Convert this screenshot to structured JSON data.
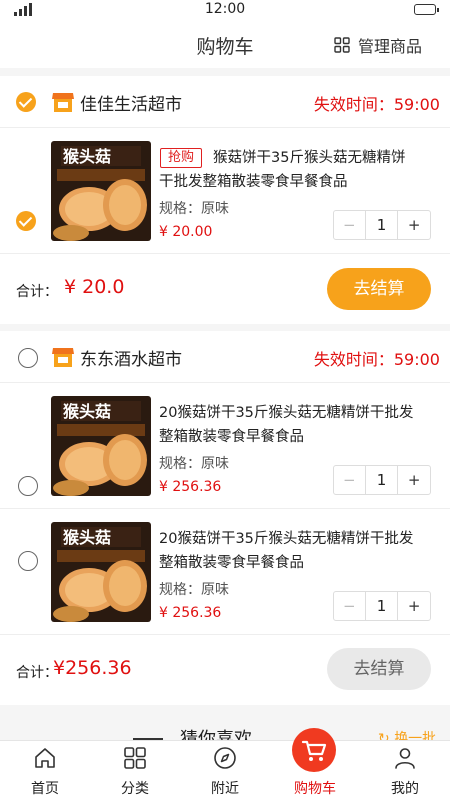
{
  "status_bar": {
    "time": "12:00"
  },
  "header": {
    "title": "购物车",
    "manage_label": "管理商品"
  },
  "stores": [
    {
      "name": "佳佳生活超市",
      "expire_text": "失效时间：59:00",
      "selected": true,
      "items": [
        {
          "selected": true,
          "tag": "抢购",
          "name": "猴菇饼干35斤猴头菇无糖精饼干批发整箱散装零食早餐食品",
          "spec": "规格：原味",
          "price": "¥ 20.00",
          "quantity": "1",
          "image_text": "猴头菇"
        }
      ],
      "total_label": "合计：",
      "total_value": "¥ 20.0",
      "checkout_label": "去结算",
      "checkout_enabled": true
    },
    {
      "name": "东东酒水超市",
      "expire_text": "失效时间：59:00",
      "selected": false,
      "items": [
        {
          "selected": false,
          "name": "20猴菇饼干35斤猴头菇无糖精饼干批发整箱散装零食早餐食品",
          "spec": "规格：原味",
          "price": "¥ 256.36",
          "quantity": "1",
          "image_text": "猴头菇"
        },
        {
          "selected": false,
          "name": "20猴菇饼干35斤猴头菇无糖精饼干批发整箱散装零食早餐食品",
          "spec": "规格：原味",
          "price": "¥ 256.36",
          "quantity": "1",
          "image_text": "猴头菇"
        }
      ],
      "total_label": "合计：",
      "total_value": "¥256.36",
      "checkout_label": "去结算",
      "checkout_enabled": false
    }
  ],
  "guess_section": {
    "title": "猜你喜欢",
    "refresh_label": "换一批"
  },
  "tabbar": {
    "items": [
      {
        "label": "首页",
        "icon": "home-icon"
      },
      {
        "label": "分类",
        "icon": "grid-icon"
      },
      {
        "label": "附近",
        "icon": "compass-icon"
      },
      {
        "label": "购物车",
        "icon": "cart-icon",
        "active": true
      },
      {
        "label": "我的",
        "icon": "person-icon"
      }
    ]
  },
  "colors": {
    "accent": "#f7a21b",
    "price_red": "#e01010",
    "tag_red": "#e02020"
  }
}
